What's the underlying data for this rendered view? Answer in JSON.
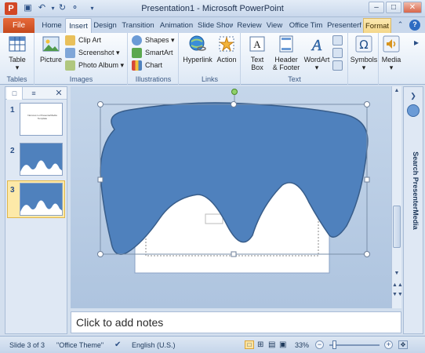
{
  "window": {
    "title": "Presentation1 - Microsoft PowerPoint",
    "app_icon": "P"
  },
  "qat": {
    "save": "save-icon",
    "undo": "undo-icon",
    "redo": "redo-icon"
  },
  "tabs": {
    "file": "File",
    "items": [
      "Home",
      "Insert",
      "Design",
      "Transition",
      "Animation",
      "Slide Show",
      "Review",
      "View",
      "Office Tim",
      "Presenterf",
      "Format"
    ],
    "active": "Insert"
  },
  "ribbon": {
    "tables": {
      "label": "Tables",
      "table": "Table"
    },
    "images": {
      "label": "Images",
      "picture": "Picture",
      "clip_art": "Clip Art",
      "screenshot": "Screenshot",
      "photo_album": "Photo Album"
    },
    "illustrations": {
      "label": "Illustrations",
      "shapes": "Shapes",
      "smartart": "SmartArt",
      "chart": "Chart"
    },
    "links": {
      "label": "Links",
      "hyperlink": "Hyperlink",
      "action": "Action"
    },
    "text": {
      "label": "Text",
      "text_box_1": "Text",
      "text_box_2": "Box",
      "header_1": "Header",
      "header_2": "& Footer",
      "wordart": "WordArt"
    },
    "symbols": {
      "label": "Symbols"
    },
    "media": {
      "label": "Media"
    }
  },
  "slides_pane": {
    "thumbs": [
      {
        "number": "1",
        "caption": "Nervous Lo PresenterMedia Template"
      },
      {
        "number": "2"
      },
      {
        "number": "3"
      }
    ],
    "selected": 3
  },
  "notes": {
    "placeholder": "Click to add notes"
  },
  "right_pane": {
    "title": "Search PresenterMedia"
  },
  "status": {
    "slide": "Slide 3 of 3",
    "theme": "\"Office Theme\"",
    "language": "English (U.S.)",
    "zoom": "33%"
  },
  "colors": {
    "shape_fill": "#4f81bd",
    "shape_stroke": "#385d8a",
    "accent": "#d24726",
    "format_tab": "#f4d78a"
  }
}
